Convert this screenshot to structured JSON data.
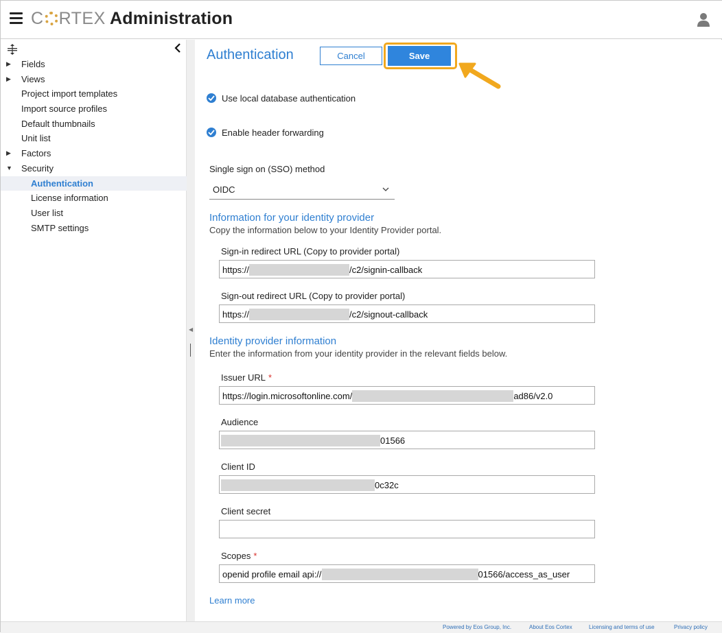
{
  "header": {
    "brand": "CORTEX",
    "title": "Administration"
  },
  "sidebar": {
    "items": [
      {
        "label": "Fields",
        "expandable": true,
        "expanded": false
      },
      {
        "label": "Views",
        "expandable": true,
        "expanded": false
      },
      {
        "label": "Project import templates",
        "expandable": false
      },
      {
        "label": "Import source profiles",
        "expandable": false
      },
      {
        "label": "Default thumbnails",
        "expandable": false
      },
      {
        "label": "Unit list",
        "expandable": false
      },
      {
        "label": "Factors",
        "expandable": true,
        "expanded": false
      },
      {
        "label": "Security",
        "expandable": true,
        "expanded": true
      },
      {
        "label": "Authentication",
        "child": true,
        "active": true
      },
      {
        "label": "License information",
        "child": true
      },
      {
        "label": "User list",
        "child": true
      },
      {
        "label": "SMTP settings",
        "child": true
      }
    ]
  },
  "main": {
    "title": "Authentication",
    "cancel_label": "Cancel",
    "save_label": "Save",
    "checkboxes": [
      {
        "label": "Use local database authentication",
        "checked": true
      },
      {
        "label": "Enable header forwarding",
        "checked": true
      }
    ],
    "sso": {
      "label": "Single sign on (SSO) method",
      "value": "OIDC"
    },
    "identity_info": {
      "title": "Information for your identity provider",
      "description": "Copy the information below to your Identity Provider portal.",
      "signin": {
        "label": "Sign-in redirect URL (Copy to provider portal)",
        "prefix": "https://",
        "suffix": "/c2/signin-callback"
      },
      "signout": {
        "label": "Sign-out redirect URL (Copy to provider portal)",
        "prefix": "https://",
        "suffix": "/c2/signout-callback"
      }
    },
    "provider_info": {
      "title": "Identity provider information",
      "description": "Enter the information from your identity provider in the relevant fields below.",
      "issuer": {
        "label": "Issuer URL",
        "required": "*",
        "prefix": "https://login.microsoftonline.com/",
        "suffix": "ad86/v2.0"
      },
      "audience": {
        "label": "Audience",
        "suffix": "01566"
      },
      "client_id": {
        "label": "Client ID",
        "suffix": "0c32c"
      },
      "client_secret": {
        "label": "Client secret",
        "value": ""
      },
      "scopes": {
        "label": "Scopes",
        "required": "*",
        "prefix": "openid profile email api://",
        "suffix": "01566/access_as_user"
      }
    },
    "learn_more": "Learn more"
  },
  "footer": {
    "powered_by": "Powered by Eos Group, Inc.",
    "about": "About Eos Cortex",
    "licensing": "Licensing and terms of use",
    "privacy": "Privacy policy"
  },
  "colors": {
    "accent": "#2f7fd1",
    "highlight": "#f1a81e",
    "required": "#d9302c"
  }
}
